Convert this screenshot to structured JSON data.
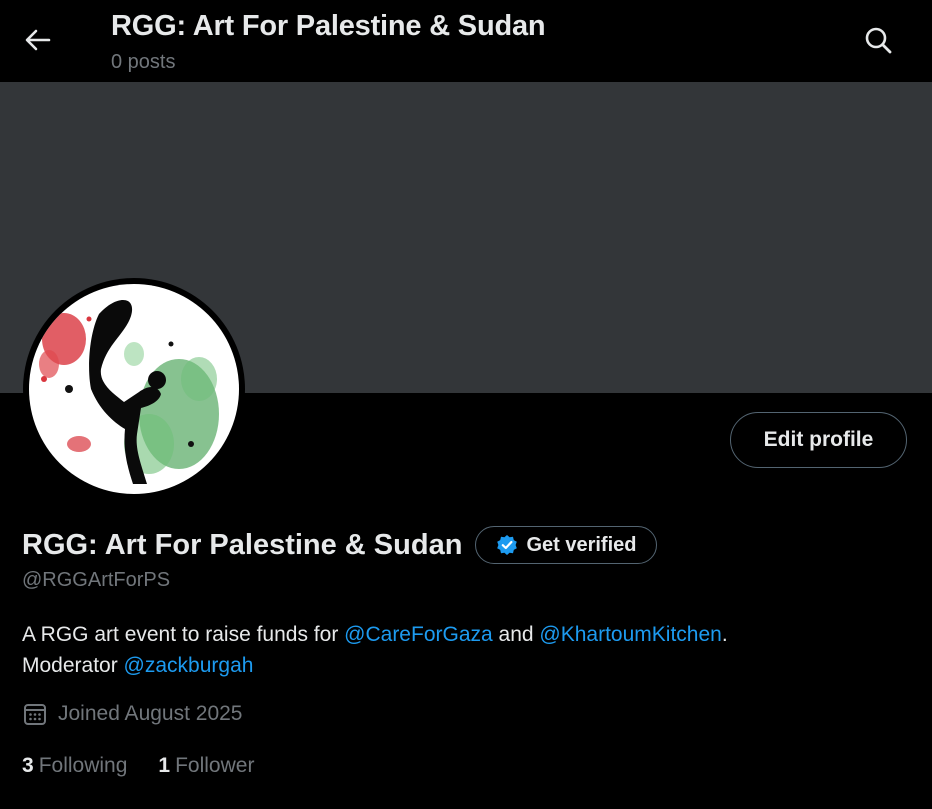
{
  "header": {
    "title": "RGG: Art For Palestine & Sudan",
    "posts_count": "0 posts",
    "back_icon": "arrow-left-icon",
    "search_icon": "search-icon"
  },
  "profile": {
    "edit_label": "Edit profile",
    "display_name": "RGG: Art For Palestine & Sudan",
    "verify_label": "Get verified",
    "handle": "@RGGArtForPS",
    "bio": {
      "part1": "A RGG art event to raise funds for ",
      "mention1": "@CareForGaza",
      "part2": " and ",
      "mention2": "@KhartoumKitchen",
      "part3": ".",
      "part4": "Moderator ",
      "mention3": "@zackburgah"
    },
    "joined": "Joined August 2025",
    "following_count": "3",
    "following_label": "Following",
    "followers_count": "1",
    "followers_label": "Follower"
  },
  "colors": {
    "background": "#000000",
    "banner": "#333639",
    "link": "#1d9bf0",
    "muted": "#71767b",
    "text": "#e7e9ea",
    "verified_badge": "#1d9bf0"
  }
}
